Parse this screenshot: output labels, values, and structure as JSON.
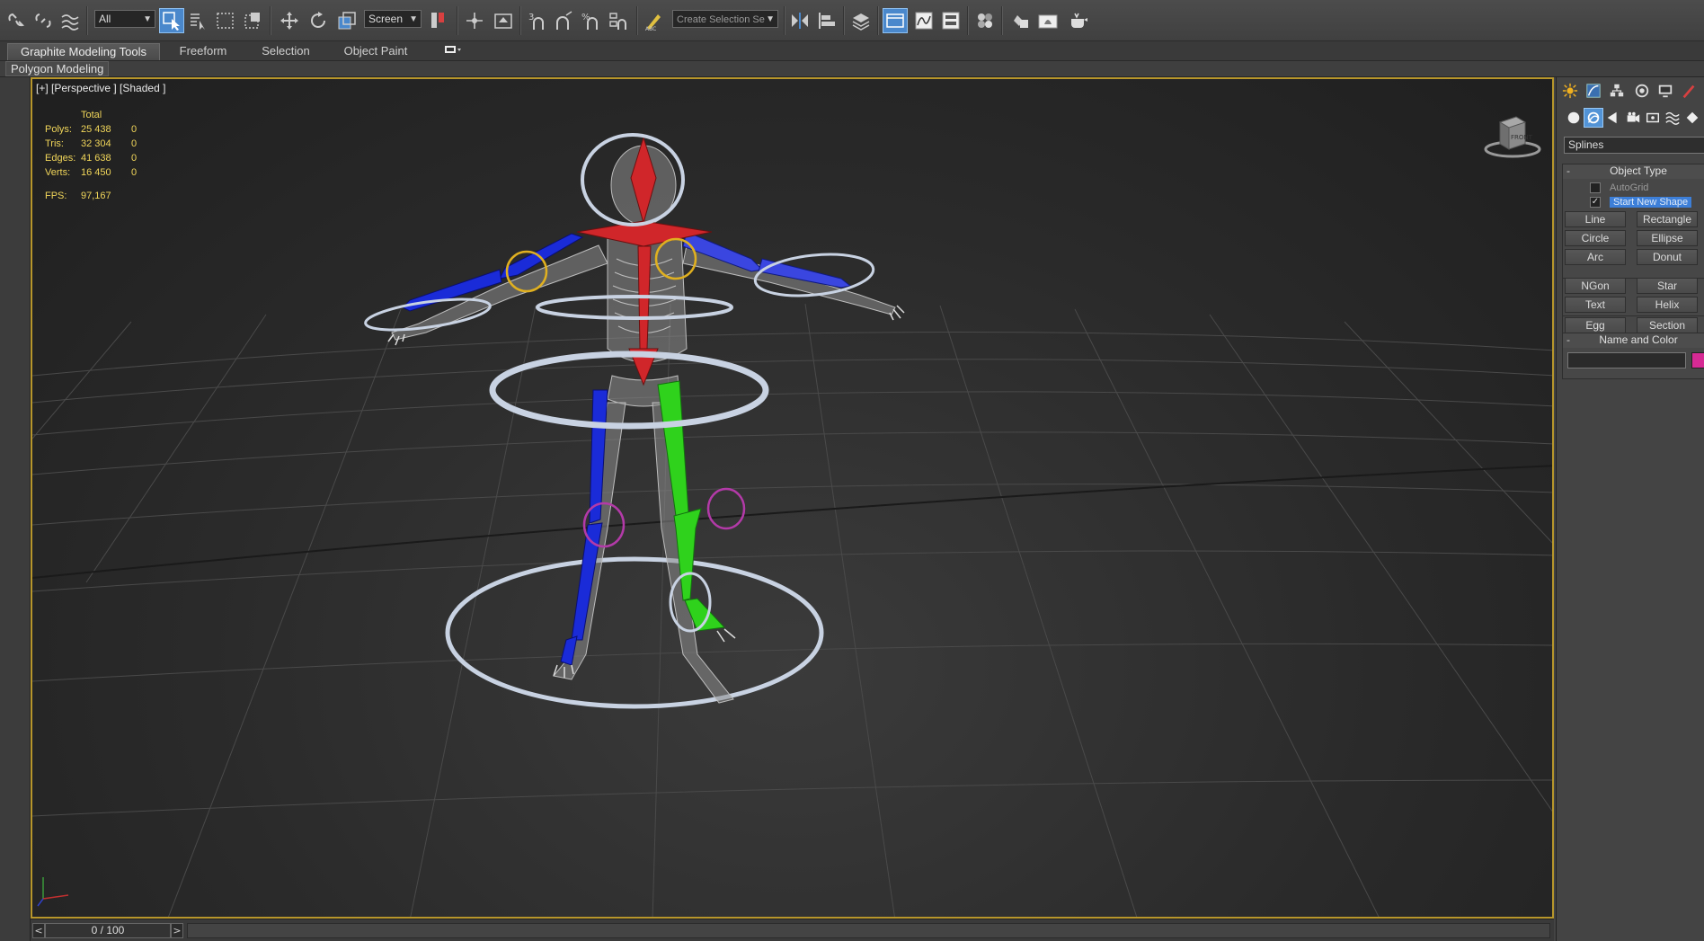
{
  "toolbar": {
    "selection_filter": "All",
    "ref_coord": "Screen",
    "named_selection_placeholder": "Create Selection Se"
  },
  "ribbon": {
    "tabs": [
      "Graphite Modeling Tools",
      "Freeform",
      "Selection",
      "Object Paint"
    ],
    "panel_label": "Polygon Modeling"
  },
  "viewport": {
    "label": "[+] [Perspective ] [Shaded ]",
    "stats": {
      "header": "Total",
      "rows": [
        {
          "label": "Polys:",
          "total": "25 438",
          "sel": "0"
        },
        {
          "label": "Tris:",
          "total": "32 304",
          "sel": "0"
        },
        {
          "label": "Edges:",
          "total": "41 638",
          "sel": "0"
        },
        {
          "label": "Verts:",
          "total": "16 450",
          "sel": "0"
        }
      ],
      "fps_label": "FPS:",
      "fps_value": "97,167"
    },
    "viewcube_label": "FRONT"
  },
  "timeline": {
    "frame": "0 / 100",
    "prev": "<",
    "next": ">"
  },
  "command_panel": {
    "category": "Splines",
    "object_type": {
      "title": "Object Type",
      "autogrid": "AutoGrid",
      "start_new_shape": "Start New Shape",
      "buttons": [
        "Line",
        "Rectangle",
        "Circle",
        "Ellipse",
        "Arc",
        "Donut",
        "NGon",
        "Star",
        "Text",
        "Helix",
        "Egg",
        "Section"
      ]
    },
    "name_color": {
      "title": "Name and Color",
      "swatch_color": "#d62a94"
    }
  },
  "colors": {
    "viewport_border": "#b7962b",
    "stats_text": "#f1d65a",
    "biped_left": "#1a2bd8",
    "biped_right": "#2fd21c",
    "biped_spine": "#d0262a",
    "accent": "#4a88cc"
  }
}
